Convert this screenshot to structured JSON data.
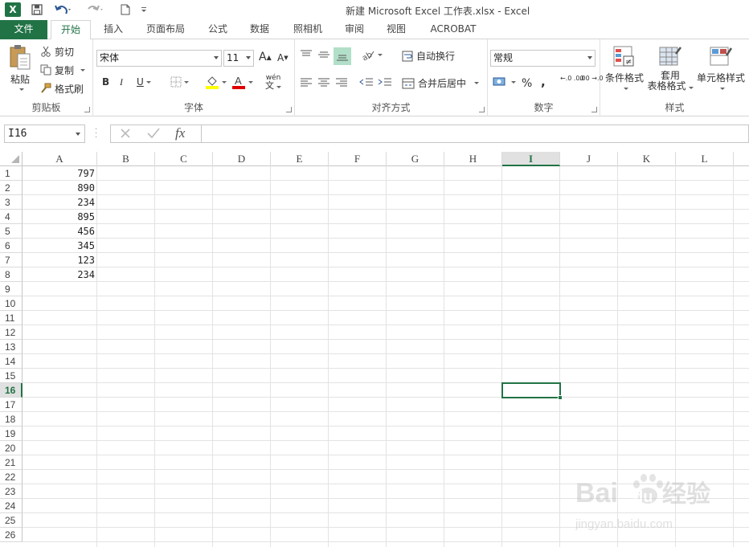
{
  "window": {
    "title": "新建 Microsoft Excel 工作表.xlsx - Excel",
    "app_icon": "X"
  },
  "qat": {
    "save": "save-icon",
    "undo": "undo-icon",
    "redo": "redo-icon",
    "new": "new-doc-icon"
  },
  "tabs": [
    {
      "label": "文件",
      "name": "file"
    },
    {
      "label": "开始",
      "name": "home"
    },
    {
      "label": "插入",
      "name": "insert"
    },
    {
      "label": "页面布局",
      "name": "page-layout"
    },
    {
      "label": "公式",
      "name": "formulas"
    },
    {
      "label": "数据",
      "name": "data"
    },
    {
      "label": "照相机",
      "name": "camera"
    },
    {
      "label": "审阅",
      "name": "review"
    },
    {
      "label": "视图",
      "name": "view"
    },
    {
      "label": "ACROBAT",
      "name": "acrobat"
    }
  ],
  "active_tab": "开始",
  "ribbon": {
    "clipboard": {
      "label": "剪贴板",
      "paste": "粘贴",
      "cut": "剪切",
      "copy": "复制",
      "format_painter": "格式刷"
    },
    "font": {
      "label": "字体",
      "font_name": "宋体",
      "font_size": "11",
      "phonetic": "wén"
    },
    "alignment": {
      "label": "对齐方式",
      "wrap_text": "自动换行",
      "merge_center": "合并后居中"
    },
    "number": {
      "label": "数字",
      "format": "常规",
      "percent": "%",
      "comma": ",",
      "inc_decimal": "←.0 .00",
      "dec_decimal": ".00 →.0"
    },
    "styles": {
      "label": "样式",
      "conditional": "条件格式",
      "table_1": "套用",
      "table_2": "表格格式",
      "cell_styles": "单元格样式"
    }
  },
  "formula_bar": {
    "name_box": "I16",
    "fx": "fx",
    "formula": ""
  },
  "columns": [
    "A",
    "B",
    "C",
    "D",
    "E",
    "F",
    "G",
    "H",
    "I",
    "J",
    "K",
    "L"
  ],
  "selected_column": "I",
  "rows": [
    "1",
    "2",
    "3",
    "4",
    "5",
    "6",
    "7",
    "8",
    "9",
    "10",
    "11",
    "12",
    "13",
    "14",
    "15",
    "16",
    "17",
    "18",
    "19",
    "20",
    "21",
    "22",
    "23",
    "24",
    "25",
    "26"
  ],
  "selected_row": "16",
  "column_a_values": [
    "797",
    "890",
    "234",
    "895",
    "456",
    "345",
    "123",
    "234"
  ],
  "watermark": {
    "text1": "Bai",
    "text2": "du",
    "text3": "经验",
    "url": "jingyan.baidu.com"
  },
  "colors": {
    "accent": "#217346",
    "grid": "#e3e3e3",
    "header_sel": "#e1e1e1"
  }
}
